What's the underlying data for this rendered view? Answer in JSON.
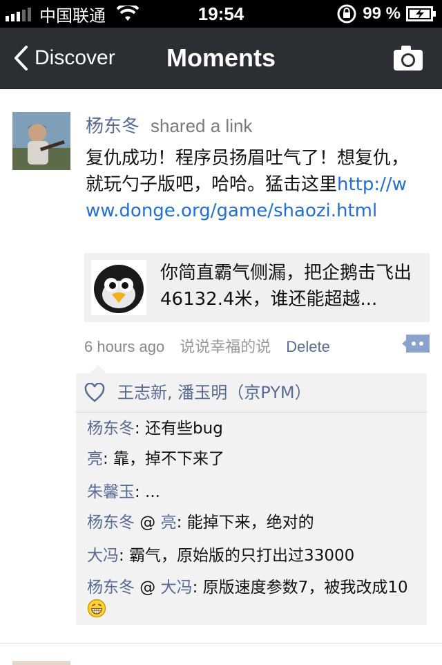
{
  "status_bar": {
    "carrier": "中国联通",
    "time": "19:54",
    "battery_percent": "99 %"
  },
  "nav": {
    "back_label": "Discover",
    "title": "Moments",
    "camera_icon": "camera-icon"
  },
  "post": {
    "author": "杨东冬",
    "action": "shared a link",
    "text": "复仇成功！程序员扬眉吐气了！想复仇，就玩勺子版吧，哈哈。猛击这里",
    "link_text": "http://www.donge.org/game/shaozi.html",
    "link_card": {
      "thumbnail_icon": "penguin-icon",
      "text": "你简直霸气侧漏，把企鹅击飞出46132.4米，谁还能超越..."
    },
    "time": "6 hours ago",
    "source": "说说幸福的说",
    "delete_label": "Delete",
    "likes": "王志新, 潘玉明（京PYM）",
    "comments": [
      {
        "from": "杨东冬",
        "to": "",
        "text": ": 还有些bug"
      },
      {
        "from": "亮",
        "to": "",
        "text": ": 靠，掉不下来了"
      },
      {
        "from": "朱馨玉",
        "to": "",
        "text": ": ..."
      },
      {
        "from": "杨东冬",
        "reply_symbol": " @ ",
        "to": "亮",
        "text": ": 能掉下来，绝对的"
      },
      {
        "from": "大冯",
        "to": "",
        "text": ": 霸气，原始版的只打出过33000"
      },
      {
        "from": "杨东冬",
        "reply_symbol": " @ ",
        "to": "大冯",
        "text": ": 原版速度参数7，被我改成10"
      }
    ]
  },
  "colors": {
    "nav_bg": "#2b2f33",
    "name_blue": "#576b95",
    "link_blue": "#1f6fd6"
  }
}
